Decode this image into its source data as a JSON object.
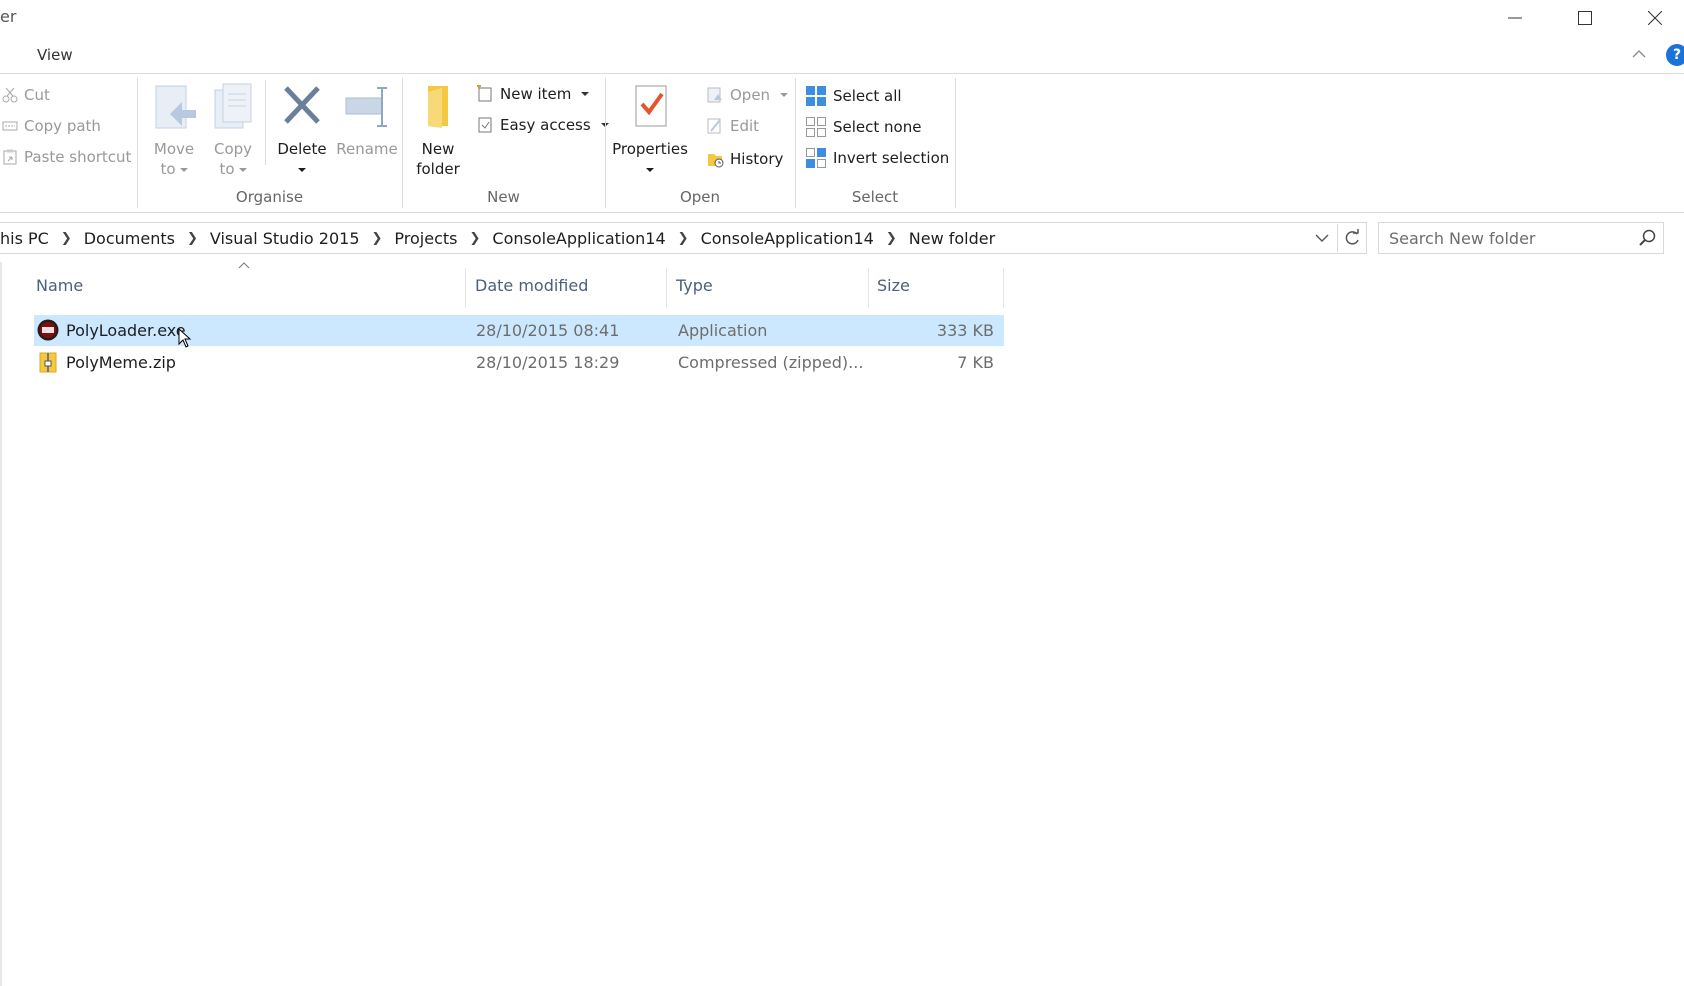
{
  "window": {
    "title": "er"
  },
  "menu": {
    "view": "View"
  },
  "ribbon": {
    "clipboard": {
      "cut": "Cut",
      "copy_path": "Copy path",
      "paste_shortcut": "Paste shortcut"
    },
    "organise": {
      "label": "Organise",
      "move_to": [
        "Move",
        "to"
      ],
      "copy_to": [
        "Copy",
        "to"
      ],
      "delete": "Delete",
      "rename": "Rename"
    },
    "new": {
      "label": "New",
      "new_folder": [
        "New",
        "folder"
      ],
      "new_item": "New item",
      "easy_access": "Easy access"
    },
    "open": {
      "label": "Open",
      "properties": "Properties",
      "open": "Open",
      "edit": "Edit",
      "history": "History"
    },
    "select": {
      "label": "Select",
      "select_all": "Select all",
      "select_none": "Select none",
      "invert_selection": "Invert selection"
    }
  },
  "address": {
    "crumbs": [
      "his PC",
      "Documents",
      "Visual Studio 2015",
      "Projects",
      "ConsoleApplication14",
      "ConsoleApplication14",
      "New folder"
    ]
  },
  "search": {
    "placeholder": "Search New folder"
  },
  "columns": {
    "name": "Name",
    "date": "Date modified",
    "type": "Type",
    "size": "Size"
  },
  "files": [
    {
      "name": "PolyLoader.exe",
      "date": "28/10/2015 08:41",
      "type": "Application",
      "size": "333 KB",
      "icon": "app-icon",
      "selected": true
    },
    {
      "name": "PolyMeme.zip",
      "date": "28/10/2015 18:29",
      "type": "Compressed (zipped)...",
      "size": "7 KB",
      "icon": "zip-folder-icon",
      "selected": false
    }
  ],
  "colors": {
    "selection": "#cce8ff",
    "accent": "#1a73d9",
    "header_text": "#4c607a"
  }
}
